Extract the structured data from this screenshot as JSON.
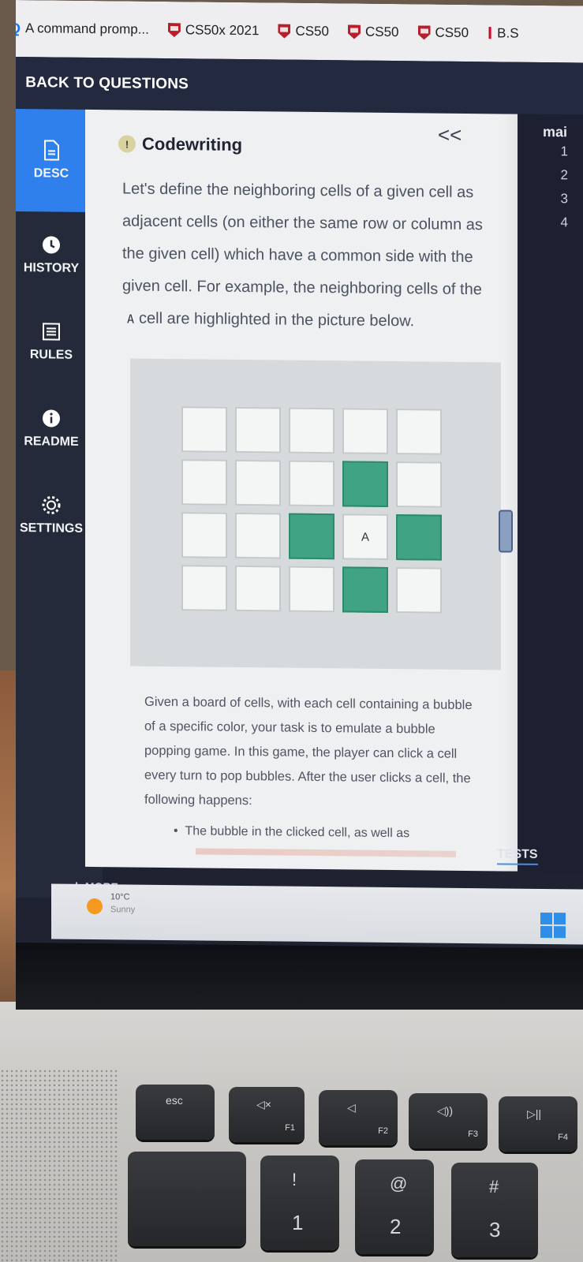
{
  "browser": {
    "tabs": [
      {
        "label": "A command promp...",
        "icon": "search-icon"
      },
      {
        "label": "CS50x 2021",
        "icon": "harvard-shield-icon"
      },
      {
        "label": "CS50",
        "icon": "harvard-shield-icon"
      },
      {
        "label": "CS50",
        "icon": "harvard-shield-icon"
      },
      {
        "label": "CS50",
        "icon": "harvard-shield-icon"
      },
      {
        "label": "B.S",
        "icon": "imdb-icon"
      }
    ]
  },
  "header": {
    "back_label": "BACK TO QUESTIONS"
  },
  "sidebar": {
    "items": [
      {
        "label": "DESC",
        "icon": "document-icon",
        "active": true
      },
      {
        "label": "HISTORY",
        "icon": "clock-icon"
      },
      {
        "label": "RULES",
        "icon": "list-icon"
      },
      {
        "label": "README",
        "icon": "info-icon"
      },
      {
        "label": "SETTINGS",
        "icon": "gear-icon"
      }
    ],
    "more_label": "MORE"
  },
  "panel": {
    "collapse_glyph": "<<",
    "task_type": "Codewriting",
    "description_before": "Let's define the neighboring cells of a given cell as adjacent cells (on either the same row or column as the given cell) which have a common side with the given cell. For example, the neighboring cells of the",
    "cell_label": "A",
    "description_after": "cell are highlighted in the picture below.",
    "grid": {
      "rows": [
        [
          "",
          "",
          "",
          "",
          ""
        ],
        [
          "",
          "",
          "",
          "hl",
          ""
        ],
        [
          "",
          "",
          "hl",
          "A",
          "hl"
        ],
        [
          "",
          "",
          "",
          "hl",
          ""
        ]
      ],
      "highlight_color": "#3fa384"
    },
    "paragraph": "Given a board of cells, with each cell containing a bubble of a specific color, your task is to emulate a bubble popping game. In this game, the player can click a cell every turn to pop bubbles. After the user clicks a cell, the following happens:",
    "bullet": "The bubble in the clicked cell, as well as"
  },
  "editor": {
    "tab_label": "mai",
    "line_numbers": [
      "1",
      "2",
      "3",
      "4"
    ],
    "tests_label": "TESTS"
  },
  "taskbar": {
    "temp": "10°C",
    "condition": "Sunny"
  },
  "keyboard": {
    "keys": [
      {
        "id": "esc",
        "label": "esc"
      },
      {
        "id": "f1",
        "label": "F1"
      },
      {
        "id": "f2",
        "label": "F2"
      },
      {
        "id": "f3",
        "label": "F3"
      },
      {
        "id": "f4",
        "label": "F4"
      },
      {
        "id": "k1",
        "top": "!",
        "bottom": "1"
      },
      {
        "id": "k2",
        "top": "@",
        "bottom": "2"
      },
      {
        "id": "k3",
        "top": "#",
        "bottom": "3"
      }
    ]
  }
}
